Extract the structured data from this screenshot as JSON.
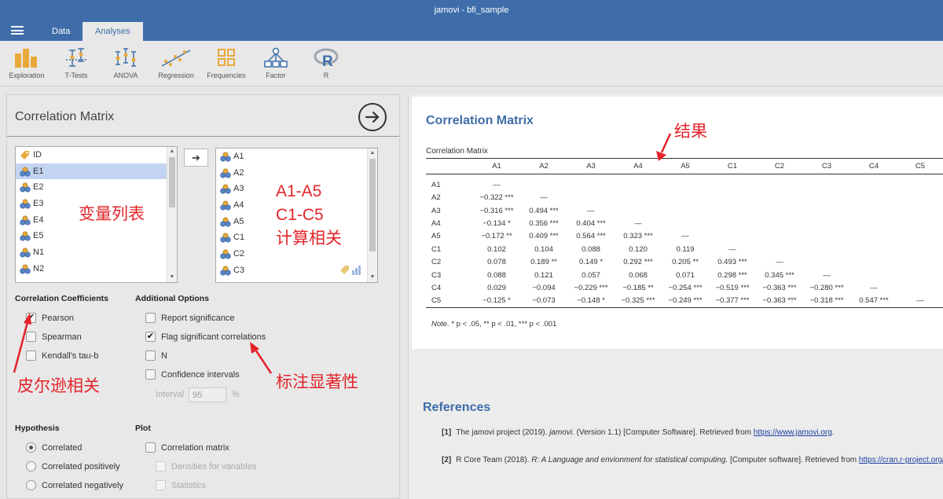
{
  "app": {
    "title": "jamovi - bfi_sample"
  },
  "tabs": {
    "data": "Data",
    "analyses": "Analyses"
  },
  "ribbon": [
    "Exploration",
    "T-Tests",
    "ANOVA",
    "Regression",
    "Frequencies",
    "Factor",
    "R"
  ],
  "options": {
    "title": "Correlation Matrix",
    "available_vars": [
      "ID",
      "E1",
      "E2",
      "E3",
      "E4",
      "E5",
      "N1",
      "N2"
    ],
    "selected_vars": [
      "A1",
      "A2",
      "A3",
      "A4",
      "A5",
      "C1",
      "C2",
      "C3"
    ],
    "coefficients": {
      "header": "Correlation Coefficients",
      "pearson": "Pearson",
      "spearman": "Spearman",
      "kendall": "Kendall's tau-b"
    },
    "additional": {
      "header": "Additional Options",
      "report_sig": "Report significance",
      "flag_sig": "Flag significant correlations",
      "n": "N",
      "ci": "Confidence intervals",
      "interval_label": "Interval",
      "interval_value": "95",
      "interval_unit": "%"
    },
    "hypothesis": {
      "header": "Hypothesis",
      "correlated": "Correlated",
      "positive": "Correlated positively",
      "negative": "Correlated negatively"
    },
    "plot": {
      "header": "Plot",
      "matrix": "Correlation matrix",
      "densities": "Densities for variables",
      "statistics": "Statistics"
    }
  },
  "annotations": {
    "var_list": "变量列表",
    "selected_1": "A1-A5",
    "selected_2": "C1-C5",
    "selected_3": "计算相关",
    "pearson": "皮尔逊相关",
    "flag": "标注显著性",
    "result": "结果"
  },
  "results": {
    "title": "Correlation Matrix",
    "table_title": "Correlation Matrix",
    "columns": [
      "A1",
      "A2",
      "A3",
      "A4",
      "A5",
      "C1",
      "C2",
      "C3",
      "C4",
      "C5"
    ],
    "rows": [
      {
        "label": "A1",
        "cells": [
          "—",
          "",
          "",
          "",
          "",
          "",
          "",
          "",
          "",
          ""
        ]
      },
      {
        "label": "A2",
        "cells": [
          "−0.322 ***",
          "—",
          "",
          "",
          "",
          "",
          "",
          "",
          "",
          ""
        ]
      },
      {
        "label": "A3",
        "cells": [
          "−0.316 ***",
          "0.494 ***",
          "—",
          "",
          "",
          "",
          "",
          "",
          "",
          ""
        ]
      },
      {
        "label": "A4",
        "cells": [
          "−0.134 *",
          "0.356 ***",
          "0.404 ***",
          "—",
          "",
          "",
          "",
          "",
          "",
          ""
        ]
      },
      {
        "label": "A5",
        "cells": [
          "−0.172 **",
          "0.409 ***",
          "0.564 ***",
          "0.323 ***",
          "—",
          "",
          "",
          "",
          "",
          ""
        ]
      },
      {
        "label": "C1",
        "cells": [
          "0.102",
          "0.104",
          "0.088",
          "0.120",
          "0.119",
          "—",
          "",
          "",
          "",
          ""
        ]
      },
      {
        "label": "C2",
        "cells": [
          "0.078",
          "0.189 **",
          "0.149 *",
          "0.292 ***",
          "0.205 **",
          "0.493 ***",
          "—",
          "",
          "",
          ""
        ]
      },
      {
        "label": "C3",
        "cells": [
          "0.088",
          "0.121",
          "0.057",
          "0.068",
          "0.071",
          "0.298 ***",
          "0.345 ***",
          "—",
          "",
          ""
        ]
      },
      {
        "label": "C4",
        "cells": [
          "0.029",
          "−0.094",
          "−0.229 ***",
          "−0.185 **",
          "−0.254 ***",
          "−0.519 ***",
          "−0.363 ***",
          "−0.280 ***",
          "—",
          ""
        ]
      },
      {
        "label": "C5",
        "cells": [
          "−0.125 *",
          "−0.073",
          "−0.148 *",
          "−0.325 ***",
          "−0.249 ***",
          "−0.377 ***",
          "−0.363 ***",
          "−0.318 ***",
          "0.547 ***",
          "—"
        ]
      }
    ],
    "note_label": "Note.",
    "note_text": "* p < .05, ** p < .01, *** p < .001",
    "references_title": "References",
    "ref1": {
      "num": "[1]",
      "pre": "The jamovi project (2019). ",
      "ital": "jamovi.",
      "mid": " (Version 1.1) [Computer Software]. Retrieved from ",
      "link": "https://www.jamovi.org",
      "post": "."
    },
    "ref2": {
      "num": "[2]",
      "pre": "R Core Team (2018). ",
      "ital": "R: A Language and envionment for statistical computing.",
      "mid": " [Computer software]. Retrieved from ",
      "link": "https://cran.r-project.org/",
      "post": ""
    }
  },
  "colors": {
    "brand": "#3e6da9",
    "annotation": "#e4242a",
    "selected_row": "#c3d4f0"
  }
}
